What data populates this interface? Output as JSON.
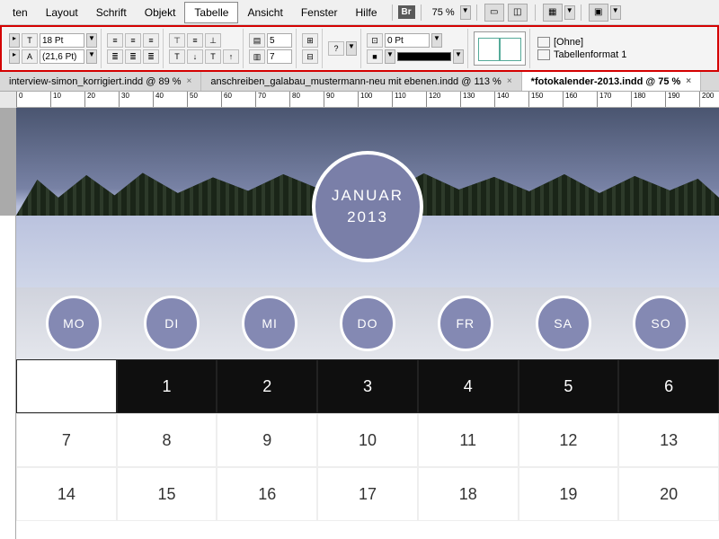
{
  "menu": {
    "items": [
      "ten",
      "Layout",
      "Schrift",
      "Objekt",
      "Tabelle",
      "Ansicht",
      "Fenster",
      "Hilfe"
    ],
    "active_index": 4,
    "br_label": "Br",
    "zoom": "75 %"
  },
  "panel": {
    "font_size": "18 Pt",
    "leading": "(21,6 Pt)",
    "rows": "5",
    "cols": "7",
    "inset": "0 Pt",
    "style_none": "[Ohne]",
    "style_fmt1": "Tabellenformat 1"
  },
  "tabs": [
    {
      "label": "interview-simon_korrigiert.indd @ 89 %",
      "active": false
    },
    {
      "label": "anschreiben_galabau_mustermann-neu mit ebenen.indd @ 113 %",
      "active": false
    },
    {
      "label": "*fotokalender-2013.indd @ 75 %",
      "active": true
    }
  ],
  "ruler_ticks": [
    0,
    10,
    20,
    30,
    40,
    50,
    60,
    70,
    80,
    90,
    100,
    110,
    120,
    130,
    140,
    150,
    160,
    170,
    180,
    190,
    200
  ],
  "calendar": {
    "month": "JANUAR",
    "year": "2013",
    "days": [
      "MO",
      "DI",
      "MI",
      "DO",
      "FR",
      "SA",
      "SO"
    ],
    "rows": [
      [
        "",
        "1",
        "2",
        "3",
        "4",
        "5",
        "6"
      ],
      [
        "7",
        "8",
        "9",
        "10",
        "11",
        "12",
        "13"
      ],
      [
        "14",
        "15",
        "16",
        "17",
        "18",
        "19",
        "20"
      ]
    ]
  }
}
